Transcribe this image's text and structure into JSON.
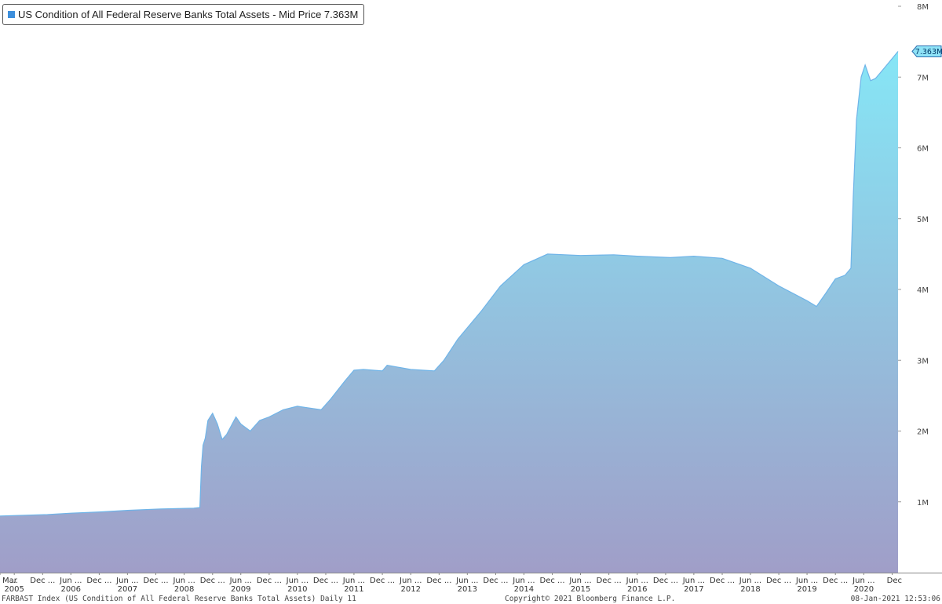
{
  "legend": {
    "label": "US Condition of All Federal Reserve Banks Total Assets - Mid Price 7.363M",
    "swatch_color": "#3d8fdc"
  },
  "footer": {
    "left": "FARBAST Index (US Condition of All Federal Reserve Banks Total Assets)  Daily 11",
    "center": "Copyright© 2021 Bloomberg Finance L.P.",
    "right": "08-Jan-2021 12:53:06"
  },
  "chart_data": {
    "type": "area",
    "title": "",
    "xlabel": "",
    "ylabel": "",
    "x_range": [
      "2005-03-01",
      "2021-01-08"
    ],
    "ylim": [
      0,
      8000000
    ],
    "y_ticks": [
      {
        "value": 1000000,
        "label": "1M"
      },
      {
        "value": 2000000,
        "label": "2M"
      },
      {
        "value": 3000000,
        "label": "3M"
      },
      {
        "value": 4000000,
        "label": "4M"
      },
      {
        "value": 5000000,
        "label": "5M"
      },
      {
        "value": 6000000,
        "label": "6M"
      },
      {
        "value": 7000000,
        "label": "7M"
      },
      {
        "value": 8000000,
        "label": "8M"
      }
    ],
    "x_ticks_month": [
      {
        "date": "2005-03-01",
        "label": "Mar"
      },
      {
        "date": "2005-06-01",
        "label": "..."
      },
      {
        "date": "2005-12-01",
        "label": "Dec ..."
      },
      {
        "date": "2006-06-01",
        "label": "Jun ..."
      },
      {
        "date": "2006-12-01",
        "label": "Dec ..."
      },
      {
        "date": "2007-06-01",
        "label": "Jun ..."
      },
      {
        "date": "2007-12-01",
        "label": "Dec ..."
      },
      {
        "date": "2008-06-01",
        "label": "Jun ..."
      },
      {
        "date": "2008-12-01",
        "label": "Dec ..."
      },
      {
        "date": "2009-06-01",
        "label": "Jun ..."
      },
      {
        "date": "2009-12-01",
        "label": "Dec ..."
      },
      {
        "date": "2010-06-01",
        "label": "Jun ..."
      },
      {
        "date": "2010-12-01",
        "label": "Dec ..."
      },
      {
        "date": "2011-06-01",
        "label": "Jun ..."
      },
      {
        "date": "2011-12-01",
        "label": "Dec ..."
      },
      {
        "date": "2012-06-01",
        "label": "Jun ..."
      },
      {
        "date": "2012-12-01",
        "label": "Dec ..."
      },
      {
        "date": "2013-06-01",
        "label": "Jun ..."
      },
      {
        "date": "2013-12-01",
        "label": "Dec ..."
      },
      {
        "date": "2014-06-01",
        "label": "Jun ..."
      },
      {
        "date": "2014-12-01",
        "label": "Dec ..."
      },
      {
        "date": "2015-06-01",
        "label": "Jun ..."
      },
      {
        "date": "2015-12-01",
        "label": "Dec ..."
      },
      {
        "date": "2016-06-01",
        "label": "Jun ..."
      },
      {
        "date": "2016-12-01",
        "label": "Dec ..."
      },
      {
        "date": "2017-06-01",
        "label": "Jun ..."
      },
      {
        "date": "2017-12-01",
        "label": "Dec ..."
      },
      {
        "date": "2018-06-01",
        "label": "Jun ..."
      },
      {
        "date": "2018-12-01",
        "label": "Dec ..."
      },
      {
        "date": "2019-06-01",
        "label": "Jun ..."
      },
      {
        "date": "2019-12-01",
        "label": "Dec ..."
      },
      {
        "date": "2020-06-01",
        "label": "Jun ..."
      },
      {
        "date": "2020-12-01",
        "label": "Dec"
      }
    ],
    "x_ticks_year": [
      {
        "date": "2005-06-01",
        "label": "2005"
      },
      {
        "date": "2006-06-01",
        "label": "2006"
      },
      {
        "date": "2007-06-01",
        "label": "2007"
      },
      {
        "date": "2008-06-01",
        "label": "2008"
      },
      {
        "date": "2009-06-01",
        "label": "2009"
      },
      {
        "date": "2010-06-01",
        "label": "2010"
      },
      {
        "date": "2011-06-01",
        "label": "2011"
      },
      {
        "date": "2012-06-01",
        "label": "2012"
      },
      {
        "date": "2013-06-01",
        "label": "2013"
      },
      {
        "date": "2014-06-01",
        "label": "2014"
      },
      {
        "date": "2015-06-01",
        "label": "2015"
      },
      {
        "date": "2016-06-01",
        "label": "2016"
      },
      {
        "date": "2017-06-01",
        "label": "2017"
      },
      {
        "date": "2018-06-01",
        "label": "2018"
      },
      {
        "date": "2019-06-01",
        "label": "2019"
      },
      {
        "date": "2020-06-01",
        "label": "2020"
      }
    ],
    "last_value_label": "7.363M",
    "last_value": 7363000,
    "fill_top_color": "#86e6f6",
    "fill_bottom_color": "#a09ec8",
    "line_color": "#6fb4e8",
    "grid": false,
    "series": [
      {
        "points": [
          [
            "2005-03-01",
            800000
          ],
          [
            "2006-01-01",
            820000
          ],
          [
            "2006-06-01",
            840000
          ],
          [
            "2007-01-01",
            860000
          ],
          [
            "2007-06-01",
            880000
          ],
          [
            "2008-01-01",
            900000
          ],
          [
            "2008-08-01",
            910000
          ],
          [
            "2008-09-10",
            920000
          ],
          [
            "2008-09-20",
            1500000
          ],
          [
            "2008-10-01",
            1800000
          ],
          [
            "2008-10-15",
            1900000
          ],
          [
            "2008-11-01",
            2150000
          ],
          [
            "2008-12-01",
            2250000
          ],
          [
            "2009-01-01",
            2100000
          ],
          [
            "2009-02-01",
            1880000
          ],
          [
            "2009-03-01",
            1950000
          ],
          [
            "2009-05-01",
            2200000
          ],
          [
            "2009-06-01",
            2100000
          ],
          [
            "2009-07-01",
            2050000
          ],
          [
            "2009-08-01",
            2000000
          ],
          [
            "2009-10-01",
            2150000
          ],
          [
            "2009-12-01",
            2200000
          ],
          [
            "2010-03-01",
            2300000
          ],
          [
            "2010-06-01",
            2350000
          ],
          [
            "2010-08-01",
            2330000
          ],
          [
            "2010-11-01",
            2300000
          ],
          [
            "2011-01-01",
            2450000
          ],
          [
            "2011-04-01",
            2700000
          ],
          [
            "2011-06-01",
            2860000
          ],
          [
            "2011-08-01",
            2870000
          ],
          [
            "2011-12-01",
            2850000
          ],
          [
            "2012-01-01",
            2930000
          ],
          [
            "2012-06-01",
            2870000
          ],
          [
            "2012-11-01",
            2850000
          ],
          [
            "2013-01-01",
            3000000
          ],
          [
            "2013-04-01",
            3300000
          ],
          [
            "2013-09-01",
            3700000
          ],
          [
            "2014-01-01",
            4050000
          ],
          [
            "2014-06-01",
            4350000
          ],
          [
            "2014-11-01",
            4500000
          ],
          [
            "2015-06-01",
            4480000
          ],
          [
            "2016-01-01",
            4490000
          ],
          [
            "2016-06-01",
            4470000
          ],
          [
            "2017-01-01",
            4450000
          ],
          [
            "2017-06-01",
            4470000
          ],
          [
            "2017-12-01",
            4440000
          ],
          [
            "2018-06-01",
            4300000
          ],
          [
            "2018-12-01",
            4050000
          ],
          [
            "2019-06-01",
            3840000
          ],
          [
            "2019-08-01",
            3760000
          ],
          [
            "2019-10-01",
            3950000
          ],
          [
            "2019-12-01",
            4150000
          ],
          [
            "2020-02-01",
            4200000
          ],
          [
            "2020-03-10",
            4300000
          ],
          [
            "2020-03-25",
            5300000
          ],
          [
            "2020-04-15",
            6400000
          ],
          [
            "2020-05-15",
            7000000
          ],
          [
            "2020-06-10",
            7170000
          ],
          [
            "2020-07-15",
            6950000
          ],
          [
            "2020-08-15",
            6980000
          ],
          [
            "2020-10-01",
            7100000
          ],
          [
            "2020-12-15",
            7300000
          ],
          [
            "2021-01-08",
            7363000
          ]
        ]
      }
    ]
  }
}
